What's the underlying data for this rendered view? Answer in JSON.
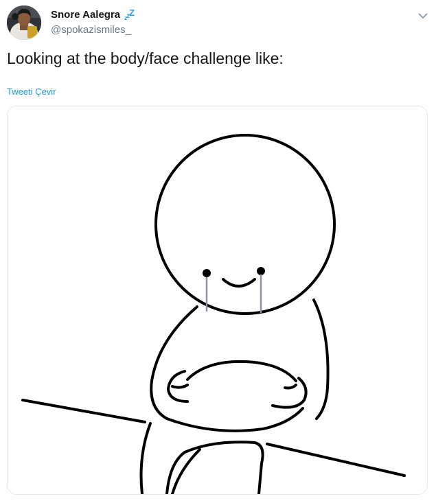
{
  "tweet": {
    "display_name": "Snore Aalegra",
    "name_emoji": "zzZ",
    "handle": "@spokazismiles_",
    "text": "Looking at the body/face challenge like:",
    "translate_label": "Tweeti Çevir"
  },
  "icons": {
    "avatar": "profile-photo",
    "caret": "chevron-down-icon",
    "name_emoji": "zzz-sleeping-symbol"
  },
  "colors": {
    "name": "#14171a",
    "handle": "#657786",
    "link": "#1b95e0",
    "emoji": "#1da1f2",
    "card_border": "#e1e8ed"
  }
}
